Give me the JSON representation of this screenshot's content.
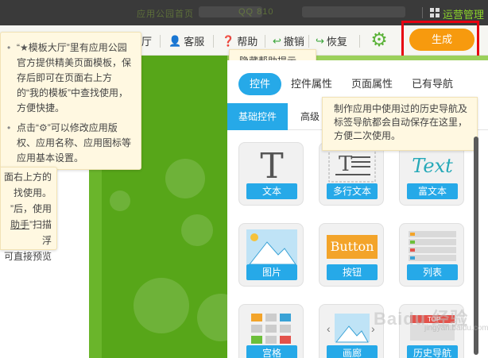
{
  "topbar": {
    "blurred_text_1": "应用公园首页",
    "blurred_text_2": "QQ 810",
    "ops_label": "运营管理"
  },
  "toolbar": {
    "hall_label": "厅",
    "service_label": "客服",
    "help_label": "帮助",
    "undo_label": "撤销",
    "redo_label": "恢复",
    "generate_label": "生成"
  },
  "help_tip": "隐藏帮助提示。",
  "left_tip": {
    "item1_prefix": "“",
    "item1_star": "★",
    "item1_text": "模板大厅”里有应用公园官方提供精美页面模板，保存后即可在页面右上方的“我的模板”中查找使用，方便快捷。",
    "item2_prefix": "点击“",
    "item2_gear": "⚙",
    "item2_text": "”可以修改应用版权、应用名称、应用图标等应用基本设置。"
  },
  "left_tip2": {
    "line1": "面右上方的",
    "line2": "找使用。",
    "line3": "”后，使用",
    "line4_underlined": "助手",
    "line4_rest": "”扫描浮",
    "line5": "可直接预览"
  },
  "panel": {
    "tabs": [
      "控件",
      "控件属性",
      "页面属性",
      "已有导航"
    ],
    "subtabs": [
      "基础控件",
      "高级"
    ],
    "cards": [
      {
        "label": "文本",
        "thumb": "T"
      },
      {
        "label": "多行文本",
        "thumb": ""
      },
      {
        "label": "富文本",
        "thumb": "Text"
      },
      {
        "label": "图片",
        "thumb": ""
      },
      {
        "label": "按钮",
        "thumb": "Button"
      },
      {
        "label": "列表",
        "thumb": ""
      },
      {
        "label": "宫格",
        "thumb": ""
      },
      {
        "label": "画廊",
        "thumb": ""
      },
      {
        "label": "历史导航",
        "thumb": "TOP"
      }
    ]
  },
  "right_tip": "制作应用中使用过的历史导航及标签导航都会自动保存在这里，方便二次使用。",
  "watermark": {
    "main": "Baidu 经验",
    "sub": "jingyan.baidu.com"
  },
  "colors": {
    "accent_blue": "#26a9e8",
    "generate_orange": "#f79a0e",
    "brand_green": "#57a619",
    "highlight_red": "#e60012"
  }
}
